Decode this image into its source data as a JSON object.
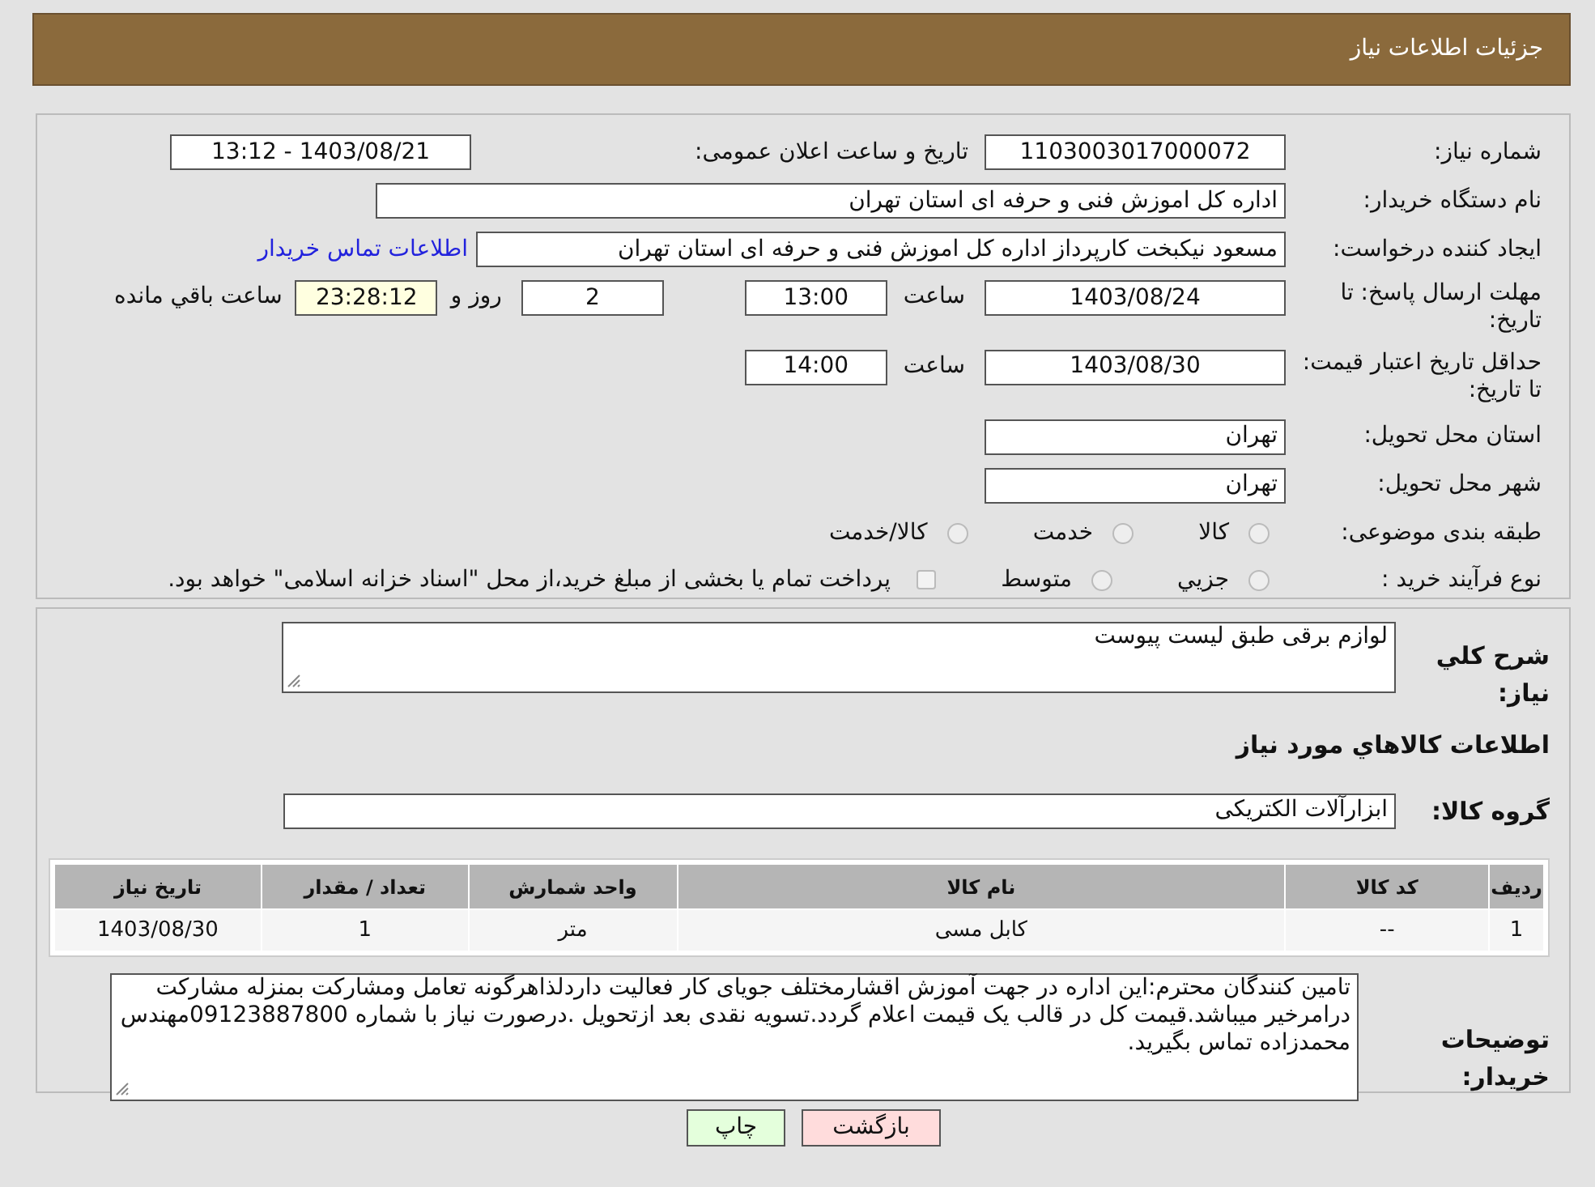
{
  "header": {
    "title": "جزئیات اطلاعات نیاز"
  },
  "details": {
    "need_number": {
      "label": "شماره نیاز:",
      "value": "1103003017000072"
    },
    "announce": {
      "label": "تاریخ و ساعت اعلان عمومی:",
      "value": "1403/08/21 - 13:12"
    },
    "buyer": {
      "label": "نام دستگاه خریدار:",
      "value": "اداره کل اموزش فنی و حرفه ای استان تهران"
    },
    "requester": {
      "label": "ایجاد کننده درخواست:",
      "value": "مسعود نیکبخت کارپرداز اداره کل اموزش فنی و حرفه ای استان تهران",
      "link": "اطلاعات تماس خریدار"
    },
    "reply_deadline": {
      "label": "مهلت ارسال پاسخ: تا تاریخ:",
      "date": "1403/08/24",
      "time_label": "ساعت",
      "time": "13:00",
      "days": "2",
      "days_label": "روز و",
      "remaining": "23:28:12",
      "remaining_label": "ساعت باقي مانده"
    },
    "price_validity": {
      "label": "حداقل تاریخ اعتبار قیمت: تا تاریخ:",
      "date": "1403/08/30",
      "time_label": "ساعت",
      "time": "14:00"
    },
    "province": {
      "label": "استان محل تحویل:",
      "value": "تهران"
    },
    "city": {
      "label": "شهر محل تحویل:",
      "value": "تهران"
    },
    "category": {
      "label": "طبقه بندی موضوعی:",
      "options": [
        {
          "kind": "radio",
          "label": "کالا",
          "selected": false
        },
        {
          "kind": "radio",
          "label": "خدمت",
          "selected": false
        },
        {
          "kind": "radio",
          "label": "کالا/خدمت",
          "selected": false
        }
      ]
    },
    "purchase_type": {
      "label": "نوع فرآیند خرید :",
      "options": [
        {
          "kind": "radio",
          "label": "جزيي",
          "selected": false
        },
        {
          "kind": "radio",
          "label": "متوسط",
          "selected": false
        },
        {
          "kind": "checkbox",
          "label": "پرداخت تمام یا بخشی از مبلغ خرید،از محل \"اسناد خزانه اسلامی\" خواهد بود.",
          "checked": false
        }
      ]
    }
  },
  "goods": {
    "description": {
      "label": "شرح کلي نياز:",
      "value": "لوازم برقی طبق لیست پیوست"
    },
    "heading": "اطلاعات کالاهاي مورد نياز",
    "group": {
      "label": "گروه کالا:",
      "value": "ابزارآلات الکتریکی"
    },
    "table": {
      "columns": [
        "ردیف",
        "کد کالا",
        "نام کالا",
        "واحد شمارش",
        "تعداد / مقدار",
        "تاریخ نیاز"
      ],
      "rows": [
        [
          "1",
          "--",
          "کابل مسی",
          "متر",
          "1",
          "1403/08/30"
        ]
      ]
    },
    "notes": {
      "label": "توضیحات خریدار:",
      "value": "تامین کنندگان محترم:این اداره در جهت آموزش اقشارمختلف جویای کار فعالیت داردلذاهرگونه تعامل ومشارکت بمنزله مشارکت درامرخیر میباشد.قیمت کل در قالب یک قیمت اعلام گردد.تسویه نقدی بعد ازتحویل .درصورت نیاز با شماره 09123887800مهندس محمدزاده تماس بگیرید."
    }
  },
  "buttons": [
    {
      "kind": "back",
      "label": "بازگشت"
    },
    {
      "kind": "print",
      "label": "چاپ"
    }
  ]
}
